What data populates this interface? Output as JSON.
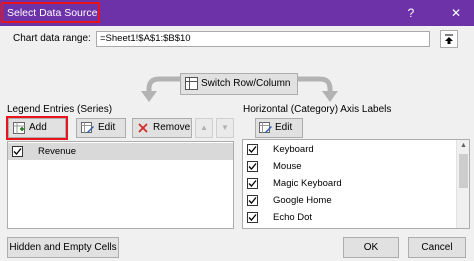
{
  "window": {
    "title": "Select Data Source",
    "help_label": "?",
    "close_label": "✕"
  },
  "range": {
    "label": "Chart data range:",
    "value": "=Sheet1!$A$1:$B$10"
  },
  "switch_button": {
    "label": "Switch Row/Column"
  },
  "legend": {
    "heading": "Legend Entries (Series)",
    "add_label": "Add",
    "edit_label": "Edit",
    "remove_label": "Remove",
    "up_label": "▲",
    "down_label": "▼",
    "series": [
      {
        "name": "Revenue",
        "checked": true,
        "selected": true
      }
    ]
  },
  "axis": {
    "heading": "Horizontal (Category) Axis Labels",
    "edit_label": "Edit",
    "items": [
      {
        "label": "Keyboard",
        "checked": true
      },
      {
        "label": "Mouse",
        "checked": true
      },
      {
        "label": "Magic Keyboard",
        "checked": true
      },
      {
        "label": "Google Home",
        "checked": true
      },
      {
        "label": "Echo Dot",
        "checked": true
      }
    ]
  },
  "footer": {
    "hidden_cells_label": "Hidden and Empty Cells",
    "ok_label": "OK",
    "cancel_label": "Cancel"
  },
  "colors": {
    "titlebar": "#6d31a8",
    "highlight": "#e8131b",
    "selected_row": "#d9d9d9"
  }
}
